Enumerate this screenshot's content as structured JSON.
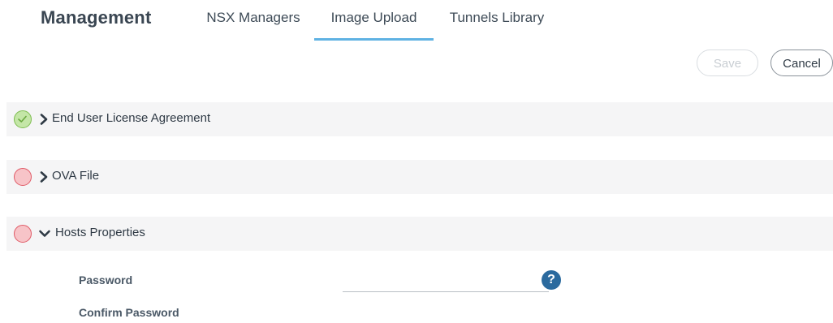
{
  "header": {
    "title": "Management",
    "tabs": [
      {
        "label": "NSX Managers",
        "active": false
      },
      {
        "label": "Image Upload",
        "active": true
      },
      {
        "label": "Tunnels Library",
        "active": false
      }
    ]
  },
  "actions": {
    "save_label": "Save",
    "cancel_label": "Cancel"
  },
  "sections": [
    {
      "label": "End User License Agreement",
      "status": "complete",
      "expanded": false
    },
    {
      "label": "OVA File",
      "status": "incomplete",
      "expanded": false
    },
    {
      "label": "Hosts Properties",
      "status": "incomplete",
      "expanded": true
    }
  ],
  "form": {
    "password_label": "Password",
    "password_value": "",
    "help_icon_glyph": "?",
    "confirm_password_label": "Confirm Password"
  },
  "colors": {
    "tab_active_underline": "#5fb2e3",
    "status_complete": "#7dbd4f",
    "status_incomplete": "#e05a66",
    "help_icon": "#2b6a9e"
  }
}
